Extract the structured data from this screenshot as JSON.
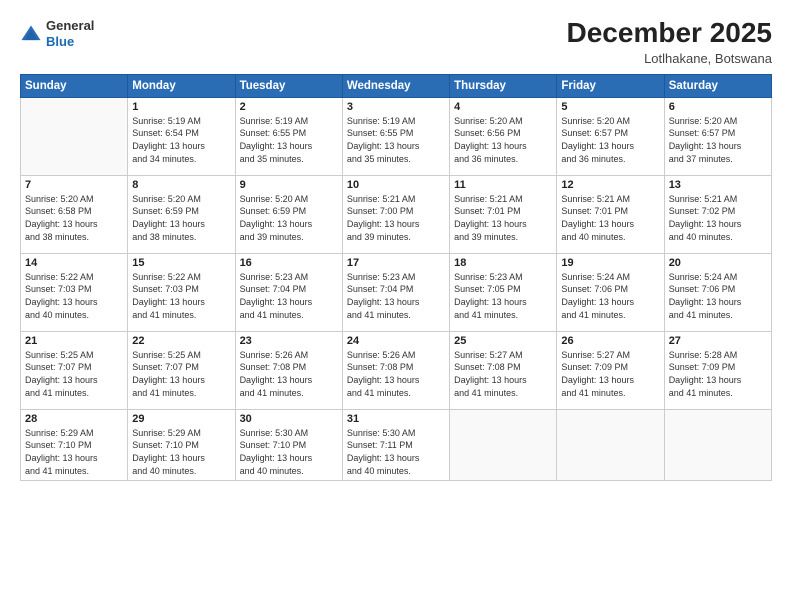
{
  "logo": {
    "general": "General",
    "blue": "Blue"
  },
  "title": "December 2025",
  "location": "Lotlhakane, Botswana",
  "header_days": [
    "Sunday",
    "Monday",
    "Tuesday",
    "Wednesday",
    "Thursday",
    "Friday",
    "Saturday"
  ],
  "weeks": [
    [
      {
        "day": "",
        "info": ""
      },
      {
        "day": "1",
        "info": "Sunrise: 5:19 AM\nSunset: 6:54 PM\nDaylight: 13 hours\nand 34 minutes."
      },
      {
        "day": "2",
        "info": "Sunrise: 5:19 AM\nSunset: 6:55 PM\nDaylight: 13 hours\nand 35 minutes."
      },
      {
        "day": "3",
        "info": "Sunrise: 5:19 AM\nSunset: 6:55 PM\nDaylight: 13 hours\nand 35 minutes."
      },
      {
        "day": "4",
        "info": "Sunrise: 5:20 AM\nSunset: 6:56 PM\nDaylight: 13 hours\nand 36 minutes."
      },
      {
        "day": "5",
        "info": "Sunrise: 5:20 AM\nSunset: 6:57 PM\nDaylight: 13 hours\nand 36 minutes."
      },
      {
        "day": "6",
        "info": "Sunrise: 5:20 AM\nSunset: 6:57 PM\nDaylight: 13 hours\nand 37 minutes."
      }
    ],
    [
      {
        "day": "7",
        "info": "Sunrise: 5:20 AM\nSunset: 6:58 PM\nDaylight: 13 hours\nand 38 minutes."
      },
      {
        "day": "8",
        "info": "Sunrise: 5:20 AM\nSunset: 6:59 PM\nDaylight: 13 hours\nand 38 minutes."
      },
      {
        "day": "9",
        "info": "Sunrise: 5:20 AM\nSunset: 6:59 PM\nDaylight: 13 hours\nand 39 minutes."
      },
      {
        "day": "10",
        "info": "Sunrise: 5:21 AM\nSunset: 7:00 PM\nDaylight: 13 hours\nand 39 minutes."
      },
      {
        "day": "11",
        "info": "Sunrise: 5:21 AM\nSunset: 7:01 PM\nDaylight: 13 hours\nand 39 minutes."
      },
      {
        "day": "12",
        "info": "Sunrise: 5:21 AM\nSunset: 7:01 PM\nDaylight: 13 hours\nand 40 minutes."
      },
      {
        "day": "13",
        "info": "Sunrise: 5:21 AM\nSunset: 7:02 PM\nDaylight: 13 hours\nand 40 minutes."
      }
    ],
    [
      {
        "day": "14",
        "info": "Sunrise: 5:22 AM\nSunset: 7:03 PM\nDaylight: 13 hours\nand 40 minutes."
      },
      {
        "day": "15",
        "info": "Sunrise: 5:22 AM\nSunset: 7:03 PM\nDaylight: 13 hours\nand 41 minutes."
      },
      {
        "day": "16",
        "info": "Sunrise: 5:23 AM\nSunset: 7:04 PM\nDaylight: 13 hours\nand 41 minutes."
      },
      {
        "day": "17",
        "info": "Sunrise: 5:23 AM\nSunset: 7:04 PM\nDaylight: 13 hours\nand 41 minutes."
      },
      {
        "day": "18",
        "info": "Sunrise: 5:23 AM\nSunset: 7:05 PM\nDaylight: 13 hours\nand 41 minutes."
      },
      {
        "day": "19",
        "info": "Sunrise: 5:24 AM\nSunset: 7:06 PM\nDaylight: 13 hours\nand 41 minutes."
      },
      {
        "day": "20",
        "info": "Sunrise: 5:24 AM\nSunset: 7:06 PM\nDaylight: 13 hours\nand 41 minutes."
      }
    ],
    [
      {
        "day": "21",
        "info": "Sunrise: 5:25 AM\nSunset: 7:07 PM\nDaylight: 13 hours\nand 41 minutes."
      },
      {
        "day": "22",
        "info": "Sunrise: 5:25 AM\nSunset: 7:07 PM\nDaylight: 13 hours\nand 41 minutes."
      },
      {
        "day": "23",
        "info": "Sunrise: 5:26 AM\nSunset: 7:08 PM\nDaylight: 13 hours\nand 41 minutes."
      },
      {
        "day": "24",
        "info": "Sunrise: 5:26 AM\nSunset: 7:08 PM\nDaylight: 13 hours\nand 41 minutes."
      },
      {
        "day": "25",
        "info": "Sunrise: 5:27 AM\nSunset: 7:08 PM\nDaylight: 13 hours\nand 41 minutes."
      },
      {
        "day": "26",
        "info": "Sunrise: 5:27 AM\nSunset: 7:09 PM\nDaylight: 13 hours\nand 41 minutes."
      },
      {
        "day": "27",
        "info": "Sunrise: 5:28 AM\nSunset: 7:09 PM\nDaylight: 13 hours\nand 41 minutes."
      }
    ],
    [
      {
        "day": "28",
        "info": "Sunrise: 5:29 AM\nSunset: 7:10 PM\nDaylight: 13 hours\nand 41 minutes."
      },
      {
        "day": "29",
        "info": "Sunrise: 5:29 AM\nSunset: 7:10 PM\nDaylight: 13 hours\nand 40 minutes."
      },
      {
        "day": "30",
        "info": "Sunrise: 5:30 AM\nSunset: 7:10 PM\nDaylight: 13 hours\nand 40 minutes."
      },
      {
        "day": "31",
        "info": "Sunrise: 5:30 AM\nSunset: 7:11 PM\nDaylight: 13 hours\nand 40 minutes."
      },
      {
        "day": "",
        "info": ""
      },
      {
        "day": "",
        "info": ""
      },
      {
        "day": "",
        "info": ""
      }
    ]
  ]
}
